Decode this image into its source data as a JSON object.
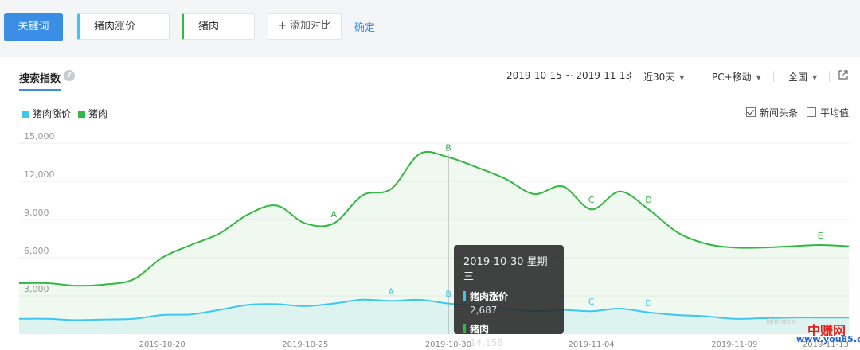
{
  "toolbar": {
    "keyword_button": "关键词",
    "keywords": [
      "猪肉涨价",
      "猪肉"
    ],
    "add_compare": "+ 添加对比",
    "confirm": "确定"
  },
  "panel": {
    "tab_title": "搜索指数",
    "help": "?",
    "date_range": "2019-10-15 ~ 2019-11-13",
    "period": "近30天",
    "device": "PC+移动",
    "region": "全国",
    "options": [
      {
        "label": "新闻头条",
        "checked": true
      },
      {
        "label": "平均值",
        "checked": false
      }
    ]
  },
  "colors": {
    "series1": "#3ec6f0",
    "series2": "#33b843",
    "accent": "#3a8ee6"
  },
  "chart_data": {
    "type": "line",
    "title": "",
    "xlabel": "",
    "ylabel": "",
    "ylim": [
      0,
      16000
    ],
    "yticks": [
      "3,000",
      "6,000",
      "9,000",
      "12,000",
      "15,000"
    ],
    "x": [
      "2019-10-15",
      "2019-10-16",
      "2019-10-17",
      "2019-10-18",
      "2019-10-19",
      "2019-10-20",
      "2019-10-21",
      "2019-10-22",
      "2019-10-23",
      "2019-10-24",
      "2019-10-25",
      "2019-10-26",
      "2019-10-27",
      "2019-10-28",
      "2019-10-29",
      "2019-10-30",
      "2019-10-31",
      "2019-11-01",
      "2019-11-02",
      "2019-11-03",
      "2019-11-04",
      "2019-11-05",
      "2019-11-06",
      "2019-11-07",
      "2019-11-08",
      "2019-11-09",
      "2019-11-10",
      "2019-11-11",
      "2019-11-12",
      "2019-11-13"
    ],
    "xticks": [
      "2019-10-20",
      "2019-10-25",
      "2019-10-30",
      "2019-11-04",
      "2019-11-09",
      "2019-11-13"
    ],
    "series": [
      {
        "name": "猪肉涨价",
        "values": [
          1200,
          1200,
          1100,
          1150,
          1200,
          1500,
          1550,
          1900,
          2300,
          2350,
          2200,
          2400,
          2700,
          2600,
          2687,
          2400,
          2200,
          2000,
          1800,
          1900,
          1800,
          2000,
          1700,
          1500,
          1400,
          1200,
          1250,
          1300,
          1300,
          1300
        ]
      },
      {
        "name": "猪肉",
        "values": [
          4000,
          4000,
          3800,
          3900,
          4300,
          6000,
          7000,
          7900,
          9400,
          10100,
          8700,
          8700,
          10900,
          11400,
          14158,
          13900,
          13100,
          12200,
          11000,
          11600,
          9800,
          11200,
          9800,
          8000,
          7100,
          6800,
          6800,
          6900,
          7000,
          6900
        ]
      }
    ],
    "annotations": [
      {
        "series": "猪肉",
        "label": "A",
        "x": "2019-10-26"
      },
      {
        "series": "猪肉",
        "label": "B",
        "x": "2019-10-30"
      },
      {
        "series": "猪肉",
        "label": "C",
        "x": "2019-11-04"
      },
      {
        "series": "猪肉",
        "label": "D",
        "x": "2019-11-06"
      },
      {
        "series": "猪肉",
        "label": "E",
        "x": "2019-11-12"
      },
      {
        "series": "猪肉涨价",
        "label": "A",
        "x": "2019-10-28"
      },
      {
        "series": "猪肉涨价",
        "label": "B",
        "x": "2019-10-30"
      },
      {
        "series": "猪肉涨价",
        "label": "C",
        "x": "2019-11-04"
      },
      {
        "series": "猪肉涨价",
        "label": "D",
        "x": "2019-11-06"
      }
    ],
    "tooltip": {
      "date": "2019-10-30 星期三",
      "rows": [
        {
          "name": "猪肉涨价",
          "value": "2,687"
        },
        {
          "name": "猪肉",
          "value": "14,158"
        }
      ]
    }
  },
  "watermark": {
    "text": "@index",
    "logo": "中赚网",
    "url": "www.you85.com"
  }
}
